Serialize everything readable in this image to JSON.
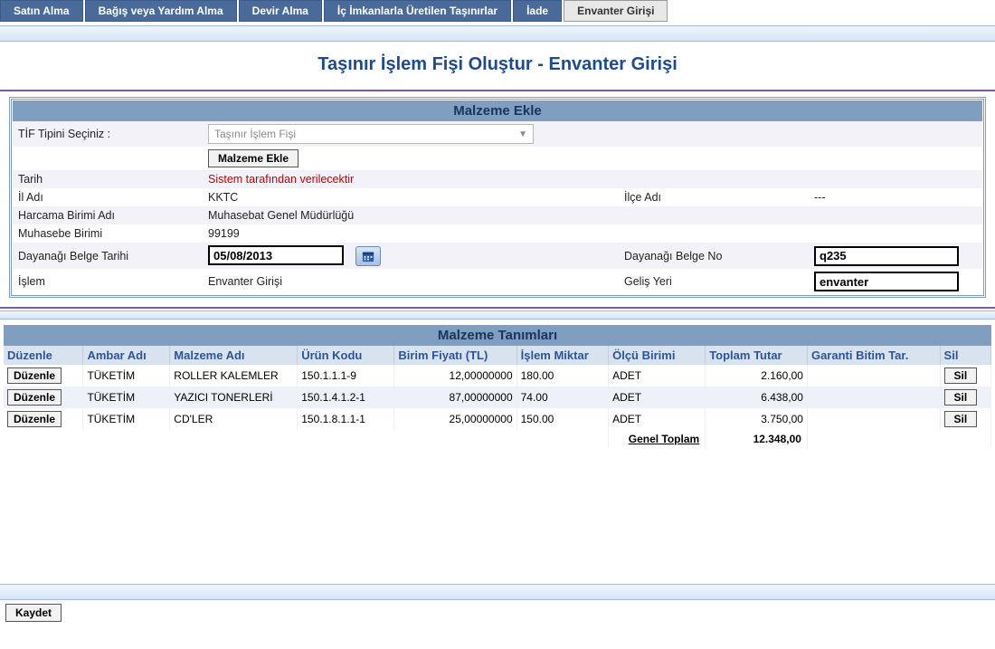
{
  "tabs": [
    {
      "label": "Satın Alma",
      "active": false
    },
    {
      "label": "Bağış veya Yardım Alma",
      "active": false
    },
    {
      "label": "Devir Alma",
      "active": false
    },
    {
      "label": "İç İmkanlarla Üretilen Taşınırlar",
      "active": false
    },
    {
      "label": "İade",
      "active": false
    },
    {
      "label": "Envanter Girişi",
      "active": true
    }
  ],
  "page_title": "Taşınır İşlem Fişi Oluştur - Envanter Girişi",
  "panel": {
    "header": "Malzeme Ekle",
    "tif_label": "TİF Tipini Seçiniz :",
    "tif_value": "Taşınır İşlem Fişi",
    "add_btn": "Malzeme Ekle",
    "tarih_label": "Tarih",
    "tarih_value": "Sistem tarafından verilecektir",
    "il_label": "İl Adı",
    "il_value": "KKTC",
    "ilce_label": "İlçe Adı",
    "ilce_value": "---",
    "harcama_label": "Harcama Birimi Adı",
    "harcama_value": "Muhasebat Genel Müdürlüğü",
    "muhasebe_label": "Muhasebe Birimi",
    "muhasebe_value": "99199",
    "belge_tarih_label": "Dayanağı Belge Tarihi",
    "belge_tarih_value": "05/08/2013",
    "belge_no_label": "Dayanağı Belge No",
    "belge_no_value": "q235",
    "islem_label": "İşlem",
    "islem_value": "Envanter Girişi",
    "gelis_label": "Geliş Yeri",
    "gelis_value": "envanter"
  },
  "grid": {
    "header": "Malzeme Tanımları",
    "cols": {
      "duzenle": "Düzenle",
      "ambar": "Ambar Adı",
      "malzeme": "Malzeme Adı",
      "urun": "Ürün Kodu",
      "birim_fiyat": "Birim Fiyatı (TL)",
      "miktar": "İşlem Miktar",
      "olcu": "Ölçü Birimi",
      "toplam": "Toplam Tutar",
      "garanti": "Garanti Bitim Tar.",
      "sil": "Sil"
    },
    "edit_btn": "Düzenle",
    "del_btn": "Sil",
    "rows": [
      {
        "ambar": "TÜKETİM",
        "malzeme": "ROLLER KALEMLER",
        "urun": "150.1.1.1-9",
        "bf": "12,00000000",
        "miktar": "180.00",
        "olcu": "ADET",
        "toplam": "2.160,00",
        "garanti": ""
      },
      {
        "ambar": "TÜKETİM",
        "malzeme": "YAZICI TONERLERİ",
        "urun": "150.1.4.1.2-1",
        "bf": "87,00000000",
        "miktar": "74.00",
        "olcu": "ADET",
        "toplam": "6.438,00",
        "garanti": ""
      },
      {
        "ambar": "TÜKETİM",
        "malzeme": "CD'LER",
        "urun": "150.1.8.1.1-1",
        "bf": "25,00000000",
        "miktar": "150.00",
        "olcu": "ADET",
        "toplam": "3.750,00",
        "garanti": ""
      }
    ],
    "total_label": "Genel Toplam",
    "total_value": "12.348,00"
  },
  "save_btn": "Kaydet"
}
